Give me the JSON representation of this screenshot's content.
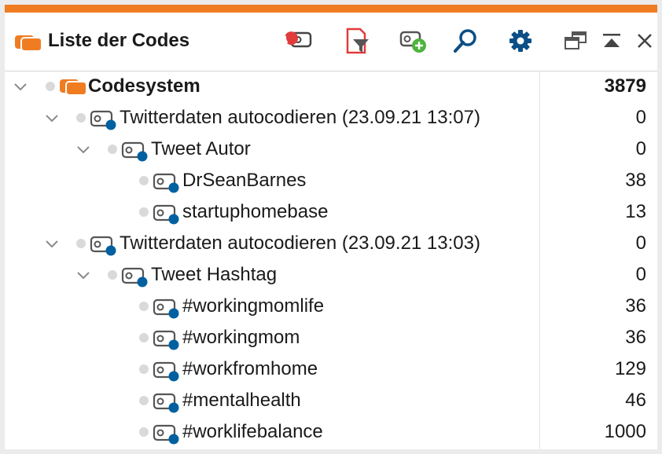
{
  "header": {
    "title": "Liste der Codes",
    "icons": {
      "title": "code-system-icon",
      "undo": "code-undo-icon",
      "filter": "document-filter-icon",
      "new_code": "new-code-icon",
      "search": "search-icon",
      "settings": "gear-icon",
      "undock": "undock-window-icon",
      "maximize": "maximize-icon",
      "close": "close-icon"
    }
  },
  "colors": {
    "accent": "#f07c22",
    "code_dot": "#0060a0",
    "settings": "#0b4f86",
    "search": "#0b4f86",
    "add": "#4db33d"
  },
  "tree": {
    "root": {
      "label": "Codesystem",
      "count": "3879"
    },
    "items": [
      {
        "label": "Twitterdaten autocodieren (23.09.21 13:07)",
        "count": "0"
      },
      {
        "label": "Tweet Autor",
        "count": "0"
      },
      {
        "label": "DrSeanBarnes",
        "count": "38"
      },
      {
        "label": "startuphomebase",
        "count": "13"
      },
      {
        "label": "Twitterdaten autocodieren (23.09.21 13:03)",
        "count": "0"
      },
      {
        "label": "Tweet Hashtag",
        "count": "0"
      },
      {
        "label": "#workingmomlife",
        "count": "36"
      },
      {
        "label": "#workingmom",
        "count": "36"
      },
      {
        "label": "#workfromhome",
        "count": "129"
      },
      {
        "label": "#mentalhealth",
        "count": "46"
      },
      {
        "label": "#worklifebalance",
        "count": "1000"
      }
    ]
  }
}
